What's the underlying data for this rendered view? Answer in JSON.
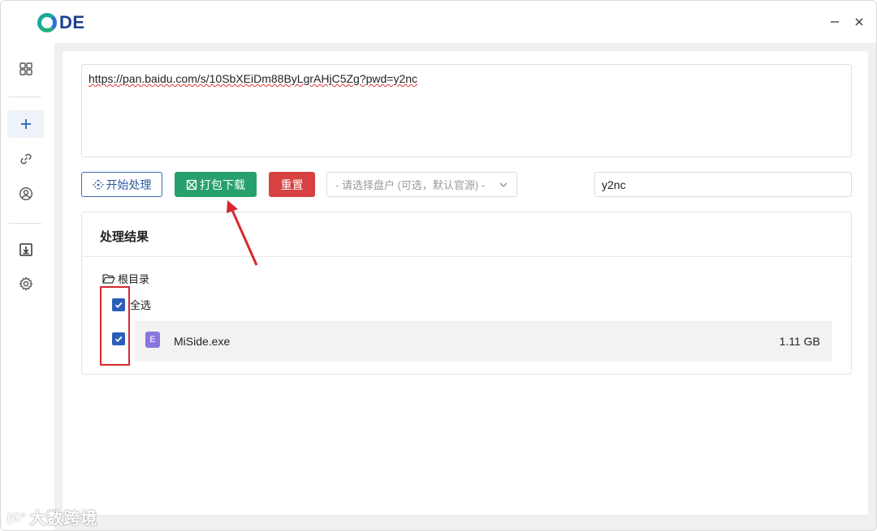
{
  "app": {
    "logo_text": "DE",
    "minimize_glyph": "—",
    "close_glyph": "✕"
  },
  "sidebar": {
    "items": [
      {
        "name": "dashboard",
        "icon": "grid-icon"
      },
      {
        "name": "add",
        "icon": "plus-icon",
        "active": true
      },
      {
        "name": "link",
        "icon": "link-icon"
      },
      {
        "name": "account",
        "icon": "user-icon"
      },
      {
        "name": "downloads",
        "icon": "download-box-icon"
      },
      {
        "name": "settings",
        "icon": "gear-icon"
      }
    ]
  },
  "url_input": {
    "value": "https://pan.baidu.com/s/10SbXEiDm88ByLgrAHjC5Zg?pwd=y2nc"
  },
  "toolbar": {
    "start_label": "开始处理",
    "pack_label": "打包下载",
    "reset_label": "重置",
    "disk_select_placeholder": "- 请选择盘户 (可选，默认官源) -",
    "password_value": "y2nc"
  },
  "results": {
    "title": "处理结果",
    "root_label": "根目录",
    "select_all_label": "全选",
    "files": [
      {
        "icon_letter": "E",
        "name": "MiSide.exe",
        "size": "1.11 GB",
        "checked": true
      }
    ]
  },
  "watermark": {
    "logo": "(C°",
    "text": "大数跨境"
  },
  "colors": {
    "accent_blue": "#2b5fb8",
    "pack_green": "#27a06b",
    "reset_red": "#d74141",
    "annotation_red": "#d7282f",
    "file_icon_purple": "#8b76e0"
  }
}
